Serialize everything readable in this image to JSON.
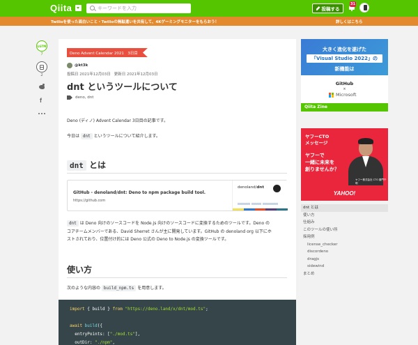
{
  "header": {
    "logo": "Qiita",
    "search_placeholder": "キーワードを入力",
    "post_button": "投稿する",
    "notification_count": "31"
  },
  "banner": {
    "text": "Twilioを使った面白いこと・Twilioの無駄遣いを共有して、4Kゲーミングモニターをもらおう！",
    "link": "詳しくはこちら"
  },
  "actions": {
    "lgtm_label": "LGTM",
    "lgtm_count": "7",
    "stock_count": "2",
    "facebook_glyph": "f"
  },
  "article": {
    "calendar_tag": "Deno Advent Calendar 2021　3日目",
    "author": "@kt3k",
    "posted": "投稿日 2021年12月03日",
    "updated": "更新日 2021年12月03日",
    "title": "dnt というツールについて",
    "tags": "deno,  dnt",
    "intro": "Deno (ディノ) Advent Calendar 3日目の記事です。",
    "intro2_pre": "今日は ",
    "intro2_code": "dnt",
    "intro2_post": " というツールについて紹介します。",
    "h2_dnt_code": "dnt",
    "h2_dnt_text": " とは",
    "card": {
      "title": "GitHub - denoland/dnt: Deno to npm package build tool.",
      "url": "https://github.com",
      "image_prefix": "denoland/",
      "image_repo": "dnt"
    },
    "desc_code": "dnt",
    "desc_line1": " は Deno 向けのソースコードを Node.js 向けのソースコードに変換するためのツールです。Deno の",
    "desc_line2": "コアチームメンバーである、David Sherret さんが主に開発しています。GitHub の denoland org 以下にホ",
    "desc_line3": "ストされており、位置付け的には Deno 公式の Deno to Node.js の変換ツールです。",
    "h2_usage": "使い方",
    "usage_pre": "次のような内容の ",
    "usage_code": "build_npm.ts",
    "usage_post": " を用意します。",
    "code": {
      "l1_kw": "import",
      "l1_mid": " { build } ",
      "l1_kw2": "from",
      "l1_str": " \"https://deno.land/x/dnt/mod.ts\"",
      "l1_end": ";",
      "l3_kw": "await",
      "l3_fn": " build",
      "l3_end": "({",
      "l4_key": "  entryPoints: [",
      "l4_str": "\"./mod.ts\"",
      "l4_end": "],",
      "l5_key": "  outDir: ",
      "l5_str": "\"./npm\"",
      "l5_end": ","
    }
  },
  "ads": {
    "ad1_line1": "大きく進化を遂げた",
    "ad1_line2": "「Visual Studio 2022」の",
    "ad1_line3": "新機能は",
    "ad1_github": "GitHub",
    "ad1_x": "×",
    "ad1_ms": "Microsoft",
    "ad1_footer": "Qiita Zine",
    "ad2_title": "ヤフーCTO\nメッセージ",
    "ad2_body": "ヤフーで\n一緒に未来を\n創りませんか？",
    "ad2_caption": "ヤフー株式会社 CTO 藤門千明",
    "ad2_logo": "YAHOO!"
  },
  "toc": [
    {
      "label": "dnt とは",
      "level": 1,
      "active": true
    },
    {
      "label": "使い方",
      "level": 1
    },
    {
      "label": "仕組み",
      "level": 1
    },
    {
      "label": "このツールの使い所",
      "level": 1
    },
    {
      "label": "採用例",
      "level": 1
    },
    {
      "label": "license_checker",
      "level": 2
    },
    {
      "label": "discordeno",
      "level": 2
    },
    {
      "label": "dragjs",
      "level": 2
    },
    {
      "label": "sidewind",
      "level": 2
    },
    {
      "label": "まとめ",
      "level": 1
    }
  ],
  "colors": {
    "brand": "#55c500",
    "banner": "#e3892e",
    "calendar_tag": "#e94f3f"
  }
}
